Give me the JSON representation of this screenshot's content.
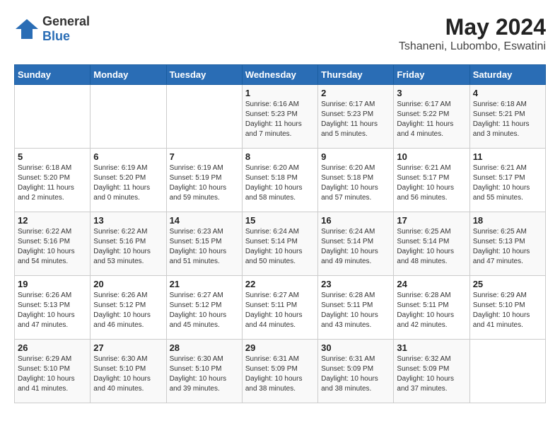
{
  "header": {
    "logo_general": "General",
    "logo_blue": "Blue",
    "title": "May 2024",
    "location": "Tshaneni, Lubombo, Eswatini"
  },
  "days_of_week": [
    "Sunday",
    "Monday",
    "Tuesday",
    "Wednesday",
    "Thursday",
    "Friday",
    "Saturday"
  ],
  "weeks": [
    [
      {
        "day": "",
        "info": ""
      },
      {
        "day": "",
        "info": ""
      },
      {
        "day": "",
        "info": ""
      },
      {
        "day": "1",
        "info": "Sunrise: 6:16 AM\nSunset: 5:23 PM\nDaylight: 11 hours\nand 7 minutes."
      },
      {
        "day": "2",
        "info": "Sunrise: 6:17 AM\nSunset: 5:23 PM\nDaylight: 11 hours\nand 5 minutes."
      },
      {
        "day": "3",
        "info": "Sunrise: 6:17 AM\nSunset: 5:22 PM\nDaylight: 11 hours\nand 4 minutes."
      },
      {
        "day": "4",
        "info": "Sunrise: 6:18 AM\nSunset: 5:21 PM\nDaylight: 11 hours\nand 3 minutes."
      }
    ],
    [
      {
        "day": "5",
        "info": "Sunrise: 6:18 AM\nSunset: 5:20 PM\nDaylight: 11 hours\nand 2 minutes."
      },
      {
        "day": "6",
        "info": "Sunrise: 6:19 AM\nSunset: 5:20 PM\nDaylight: 11 hours\nand 0 minutes."
      },
      {
        "day": "7",
        "info": "Sunrise: 6:19 AM\nSunset: 5:19 PM\nDaylight: 10 hours\nand 59 minutes."
      },
      {
        "day": "8",
        "info": "Sunrise: 6:20 AM\nSunset: 5:18 PM\nDaylight: 10 hours\nand 58 minutes."
      },
      {
        "day": "9",
        "info": "Sunrise: 6:20 AM\nSunset: 5:18 PM\nDaylight: 10 hours\nand 57 minutes."
      },
      {
        "day": "10",
        "info": "Sunrise: 6:21 AM\nSunset: 5:17 PM\nDaylight: 10 hours\nand 56 minutes."
      },
      {
        "day": "11",
        "info": "Sunrise: 6:21 AM\nSunset: 5:17 PM\nDaylight: 10 hours\nand 55 minutes."
      }
    ],
    [
      {
        "day": "12",
        "info": "Sunrise: 6:22 AM\nSunset: 5:16 PM\nDaylight: 10 hours\nand 54 minutes."
      },
      {
        "day": "13",
        "info": "Sunrise: 6:22 AM\nSunset: 5:16 PM\nDaylight: 10 hours\nand 53 minutes."
      },
      {
        "day": "14",
        "info": "Sunrise: 6:23 AM\nSunset: 5:15 PM\nDaylight: 10 hours\nand 51 minutes."
      },
      {
        "day": "15",
        "info": "Sunrise: 6:24 AM\nSunset: 5:14 PM\nDaylight: 10 hours\nand 50 minutes."
      },
      {
        "day": "16",
        "info": "Sunrise: 6:24 AM\nSunset: 5:14 PM\nDaylight: 10 hours\nand 49 minutes."
      },
      {
        "day": "17",
        "info": "Sunrise: 6:25 AM\nSunset: 5:14 PM\nDaylight: 10 hours\nand 48 minutes."
      },
      {
        "day": "18",
        "info": "Sunrise: 6:25 AM\nSunset: 5:13 PM\nDaylight: 10 hours\nand 47 minutes."
      }
    ],
    [
      {
        "day": "19",
        "info": "Sunrise: 6:26 AM\nSunset: 5:13 PM\nDaylight: 10 hours\nand 47 minutes."
      },
      {
        "day": "20",
        "info": "Sunrise: 6:26 AM\nSunset: 5:12 PM\nDaylight: 10 hours\nand 46 minutes."
      },
      {
        "day": "21",
        "info": "Sunrise: 6:27 AM\nSunset: 5:12 PM\nDaylight: 10 hours\nand 45 minutes."
      },
      {
        "day": "22",
        "info": "Sunrise: 6:27 AM\nSunset: 5:11 PM\nDaylight: 10 hours\nand 44 minutes."
      },
      {
        "day": "23",
        "info": "Sunrise: 6:28 AM\nSunset: 5:11 PM\nDaylight: 10 hours\nand 43 minutes."
      },
      {
        "day": "24",
        "info": "Sunrise: 6:28 AM\nSunset: 5:11 PM\nDaylight: 10 hours\nand 42 minutes."
      },
      {
        "day": "25",
        "info": "Sunrise: 6:29 AM\nSunset: 5:10 PM\nDaylight: 10 hours\nand 41 minutes."
      }
    ],
    [
      {
        "day": "26",
        "info": "Sunrise: 6:29 AM\nSunset: 5:10 PM\nDaylight: 10 hours\nand 41 minutes."
      },
      {
        "day": "27",
        "info": "Sunrise: 6:30 AM\nSunset: 5:10 PM\nDaylight: 10 hours\nand 40 minutes."
      },
      {
        "day": "28",
        "info": "Sunrise: 6:30 AM\nSunset: 5:10 PM\nDaylight: 10 hours\nand 39 minutes."
      },
      {
        "day": "29",
        "info": "Sunrise: 6:31 AM\nSunset: 5:09 PM\nDaylight: 10 hours\nand 38 minutes."
      },
      {
        "day": "30",
        "info": "Sunrise: 6:31 AM\nSunset: 5:09 PM\nDaylight: 10 hours\nand 38 minutes."
      },
      {
        "day": "31",
        "info": "Sunrise: 6:32 AM\nSunset: 5:09 PM\nDaylight: 10 hours\nand 37 minutes."
      },
      {
        "day": "",
        "info": ""
      }
    ]
  ]
}
